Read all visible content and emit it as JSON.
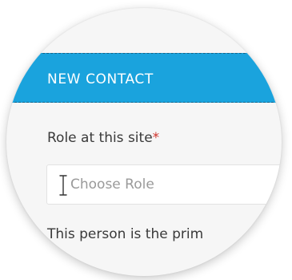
{
  "header": {
    "title": "NEW CONTACT"
  },
  "form": {
    "role_label": "Role at this site",
    "required_marker": "*",
    "role_placeholder": "Choose Role",
    "primary_text": "This person is the prim"
  },
  "colors": {
    "header_bg": "#1aa3dd",
    "required_marker": "#d0352e",
    "placeholder": "#9a9a9a"
  },
  "icons": {
    "text_cursor": "i-beam-cursor-icon"
  }
}
